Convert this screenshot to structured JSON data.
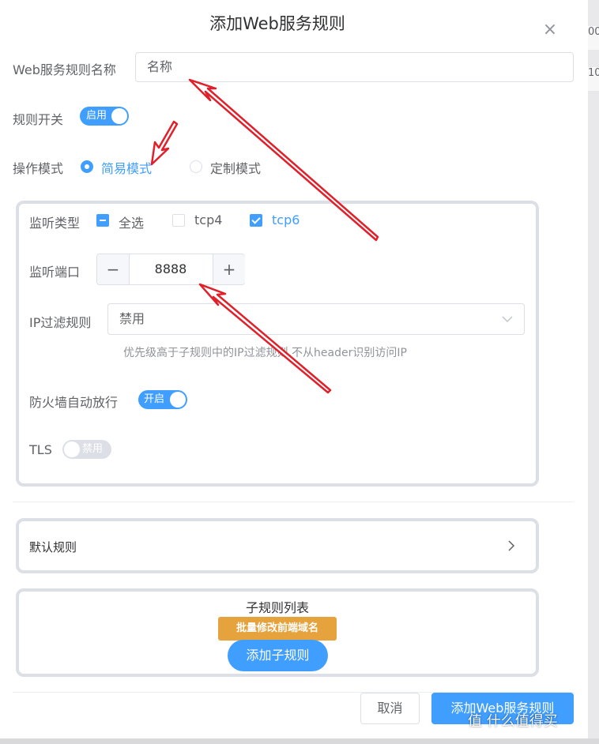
{
  "dialog": {
    "title": "添加Web服务规则",
    "close_label": "×"
  },
  "form": {
    "name_label": "Web服务规则名称",
    "name_placeholder": "名称",
    "switch_label": "规则开关",
    "switch_text": "启用",
    "mode_label": "操作模式",
    "mode_simple": "简易模式",
    "mode_custom": "定制模式"
  },
  "listen": {
    "type_label": "监听类型",
    "opt_all": "全选",
    "opt_tcp4": "tcp4",
    "opt_tcp6": "tcp6",
    "port_label": "监听端口",
    "port_value": "8888",
    "minus": "−",
    "plus": "+",
    "ip_label": "IP过滤规则",
    "ip_value": "禁用",
    "ip_hint": "优先级高于子规则中的IP过滤规则,不从header识别访问IP",
    "firewall_label": "防火墙自动放行",
    "firewall_switch": "开启",
    "tls_label": "TLS",
    "tls_switch": "禁用"
  },
  "default_rule": {
    "label": "默认规则"
  },
  "sub_rules": {
    "title": "子规则列表",
    "batch_button": "批量修改前端域名",
    "add_button": "添加子规则"
  },
  "footer": {
    "cancel": "取消",
    "confirm": "添加Web服务规则"
  },
  "watermark": {
    "text": "值 什么值得买"
  },
  "background": {
    "cell1": "00",
    "cell2": "10"
  },
  "colors": {
    "primary": "#409eff",
    "warning": "#e6a23c",
    "arrow": "#e0202a"
  }
}
